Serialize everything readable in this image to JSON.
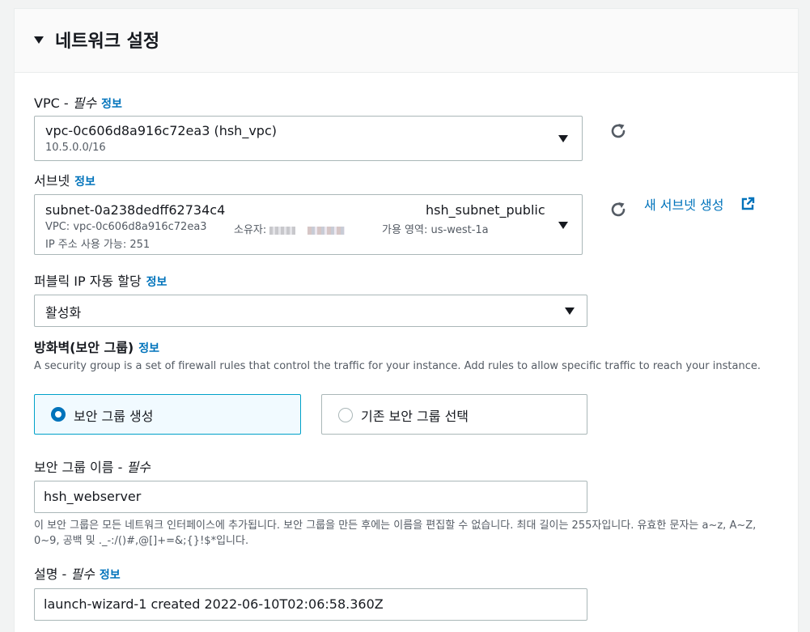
{
  "section": {
    "title": "네트워크 설정"
  },
  "vpc": {
    "label": "VPC",
    "required": "필수",
    "info": "정보",
    "selected": "vpc-0c606d8a916c72ea3 (hsh_vpc)",
    "cidr": "10.5.0.0/16"
  },
  "subnet": {
    "label": "서브넷",
    "info": "정보",
    "id": "subnet-0a238dedff62734c4",
    "name": "hsh_subnet_public",
    "vpc_line": "VPC: vpc-0c606d8a916c72ea3",
    "owner_label": "소유자:",
    "az_line": "가용 영역: us-west-1a",
    "ip_line": "IP 주소 사용 가능: 251",
    "create_link": "새 서브넷 생성"
  },
  "public_ip": {
    "label": "퍼블릭 IP 자동 할당",
    "info": "정보",
    "selected": "활성화"
  },
  "firewall": {
    "label": "방화벽(보안 그룹)",
    "info": "정보",
    "description": "A security group is a set of firewall rules that control the traffic for your instance. Add rules to allow specific traffic to reach your instance.",
    "options": [
      "보안 그룹 생성",
      "기존 보안 그룹 선택"
    ],
    "selected_index": 0
  },
  "sg_name": {
    "label": "보안 그룹 이름",
    "required": "필수",
    "value": "hsh_webserver",
    "help": "이 보안 그룹은 모든 네트워크 인터페이스에 추가됩니다. 보안 그룹을 만든 후에는 이름을 편집할 수 없습니다. 최대 길이는 255자입니다. 유효한 문자는 a~z, A~Z, 0~9, 공백 및 ._-:/()#,@[]+=&;{}!$*입니다."
  },
  "description_field": {
    "label": "설명",
    "required": "필수",
    "info": "정보",
    "value": "launch-wizard-1 created 2022-06-10T02:06:58.360Z"
  },
  "icons": {
    "section_toggle": "caret-down-icon",
    "refresh": "refresh-icon",
    "external": "external-link-icon",
    "dropdown": "caret-down-icon"
  },
  "colors": {
    "accent": "#0073bb",
    "selected_tile_bg": "#f1faff",
    "border": "#aab7b8"
  }
}
